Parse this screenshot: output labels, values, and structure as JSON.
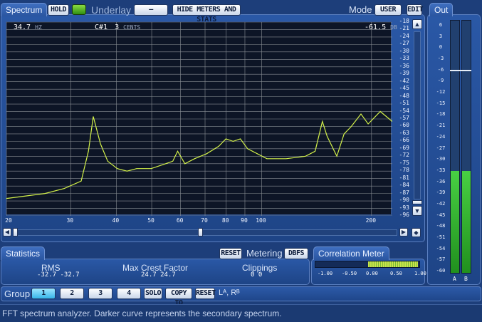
{
  "spectrum": {
    "tab_label": "Spectrum",
    "hold_label": "HOLD",
    "underlay_label": "Underlay",
    "underlay_value": "—",
    "hide_label": "HIDE METERS AND STATS",
    "mode_label": "Mode",
    "user_label": "USER",
    "edit_label": "EDIT",
    "readout_freq": "34.7",
    "readout_freq_unit": "HZ",
    "readout_note": "C#1",
    "readout_cents": "3",
    "readout_cents_unit": "CENTS",
    "readout_db": "-61.5",
    "readout_db_unit": "DB",
    "db_ticks": [
      "-18",
      "-21",
      "-24",
      "-27",
      "-30",
      "-33",
      "-36",
      "-39",
      "-42",
      "-45",
      "-48",
      "-51",
      "-54",
      "-57",
      "-60",
      "-63",
      "-66",
      "-69",
      "-72",
      "-75",
      "-78",
      "-81",
      "-84",
      "-87",
      "-90",
      "-93",
      "-96"
    ],
    "freq_ticks": [
      "20",
      "30",
      "40",
      "50",
      "60",
      "70",
      "80",
      "90",
      "100",
      "200"
    ],
    "curve": [
      [
        0,
        -89
      ],
      [
        8,
        -88
      ],
      [
        16,
        -87
      ],
      [
        24,
        -85
      ],
      [
        31,
        -82
      ],
      [
        34,
        -70
      ],
      [
        36,
        -56
      ],
      [
        39,
        -67
      ],
      [
        42,
        -74
      ],
      [
        46,
        -77
      ],
      [
        50,
        -78
      ],
      [
        54,
        -77
      ],
      [
        60,
        -77
      ],
      [
        66,
        -75
      ],
      [
        69,
        -74
      ],
      [
        71,
        -70
      ],
      [
        74,
        -75
      ],
      [
        78,
        -73
      ],
      [
        83,
        -71
      ],
      [
        88,
        -68
      ],
      [
        91,
        -65
      ],
      [
        94,
        -66
      ],
      [
        97,
        -65
      ],
      [
        100,
        -69
      ],
      [
        108,
        -73
      ],
      [
        116,
        -73
      ],
      [
        124,
        -72
      ],
      [
        128,
        -70
      ],
      [
        131,
        -58
      ],
      [
        133,
        -64
      ],
      [
        137,
        -72
      ],
      [
        140,
        -63
      ],
      [
        143,
        -60
      ],
      [
        147,
        -55
      ],
      [
        150,
        -59
      ],
      [
        155,
        -54
      ],
      [
        160,
        -58
      ]
    ],
    "colors": {
      "curve": "#d4f24a",
      "grid": "#8a8f95",
      "grid_bg": "#0d1526"
    }
  },
  "out": {
    "tab_label": "Out",
    "ticks": [
      "6",
      "3",
      "0",
      "-3",
      "-6",
      "-9",
      "-12",
      "-15",
      "-18",
      "-21",
      "-24",
      "-27",
      "-30",
      "-33",
      "-36",
      "-39",
      "-42",
      "-45",
      "-48",
      "-51",
      "-54",
      "-57",
      "-60"
    ],
    "channel_a": "A",
    "channel_b": "B",
    "peak_level_db": -6,
    "meter_level_db": -33
  },
  "statistics": {
    "tab_label": "Statistics",
    "reset_label": "RESET",
    "metering_label": "Metering",
    "dbfs_label": "DBFS",
    "rms_label": "RMS",
    "rms_values": "-32.7  -32.7",
    "crest_label": "Max Crest Factor",
    "crest_values": "24.7  24.7",
    "clip_label": "Clippings",
    "clip_values": "0      0"
  },
  "correlation": {
    "tab_label": "Correlation Meter",
    "ticks": [
      "-1.00",
      "-0.50",
      "0.00",
      "0.50",
      "1.00"
    ]
  },
  "group": {
    "label": "Group",
    "buttons": [
      "1",
      "2",
      "3",
      "4"
    ],
    "solo_label": "SOLO",
    "copyto_label": "COPY TO",
    "reset_label": "RESET",
    "channels_text": "Lᴬ, Rᴮ"
  },
  "status": {
    "text": "FFT spectrum analyzer. Darker curve represents the secondary spectrum."
  }
}
